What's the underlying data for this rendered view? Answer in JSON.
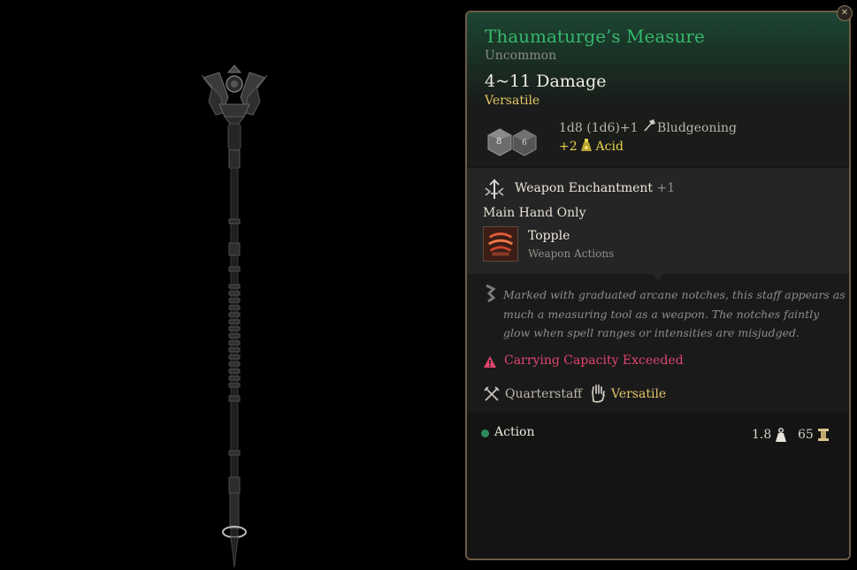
{
  "item": {
    "name": "Thaumaturge’s Measure",
    "rarity": "Uncommon",
    "damage": "4~11 Damage",
    "property_tag": "Versatile",
    "dice_faces": [
      "8",
      "6"
    ],
    "damage_main": "1d8 (1d6)+1",
    "damage_main_type": "Bludgeoning",
    "damage_extra_amount": "+2",
    "damage_extra_type": "Acid"
  },
  "enchantment": {
    "name": "Weapon Enchantment",
    "bonus": "+1",
    "restriction": "Main Hand Only",
    "action_name": "Topple",
    "action_category": "Weapon Actions"
  },
  "description": "Marked with graduated arcane notches, this staff appears as much a measuring tool as a weapon. The notches faintly glow when spell ranges or intensities are misjudged.",
  "warning": "Carrying Capacity Exceeded",
  "traits": {
    "weapon_type": "Quarterstaff",
    "property": "Versatile"
  },
  "footer": {
    "action_label": "Action",
    "weight": "1.8",
    "value": "65"
  },
  "icons": {
    "close": "close-icon",
    "dice": "dice-icon",
    "bludgeoning": "hammer-icon",
    "acid": "acid-flask-icon",
    "enchantment": "weapon-enchantment-icon",
    "topple": "topple-action-icon",
    "lore": "lore-scroll-icon",
    "warning": "warning-icon",
    "quarterstaff": "crossed-weapons-icon",
    "versatile": "hand-icon",
    "weight": "weight-icon",
    "gold": "gold-icon"
  },
  "colors": {
    "title": "#35b86b",
    "versatile": "#e5c569",
    "acid": "#e8d34a",
    "warning": "#e0456e",
    "border": "#6d5a44",
    "action_dot": "#2f8a5b"
  }
}
